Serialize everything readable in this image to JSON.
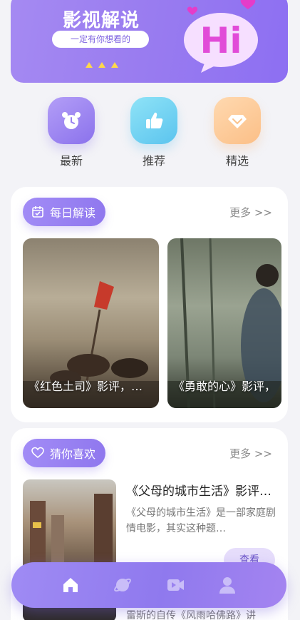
{
  "banner": {
    "title": "影视解说",
    "subtitle": "一定有你想看的",
    "art_text": "Hi"
  },
  "categories": [
    {
      "label": "最新",
      "icon": "alarm-clock-icon"
    },
    {
      "label": "推荐",
      "icon": "thumbs-up-icon"
    },
    {
      "label": "精选",
      "icon": "diamond-icon"
    }
  ],
  "daily": {
    "tag": "每日解读",
    "more": "更多 >>",
    "posters": [
      {
        "caption": "《红色土司》影评，…"
      },
      {
        "caption": "《勇敢的心》影评，"
      }
    ]
  },
  "guess": {
    "tag": "猜你喜欢",
    "more": "更多 >>",
    "item": {
      "title": "《父母的城市生活》影评…",
      "desc": "《父母的城市生活》是一部家庭剧情电影，其实这种题…",
      "button": "查看"
    },
    "next_desc": "雷斯的自传《风雨哈佛路》讲"
  },
  "tabbar": {
    "tabs": [
      "home-icon",
      "planet-icon",
      "video-icon",
      "user-icon"
    ],
    "active": "home-icon"
  },
  "colors": {
    "accent": "#9a7df0",
    "tab_active": "#ffffff",
    "tab_inactive": "#c9bdf8"
  }
}
